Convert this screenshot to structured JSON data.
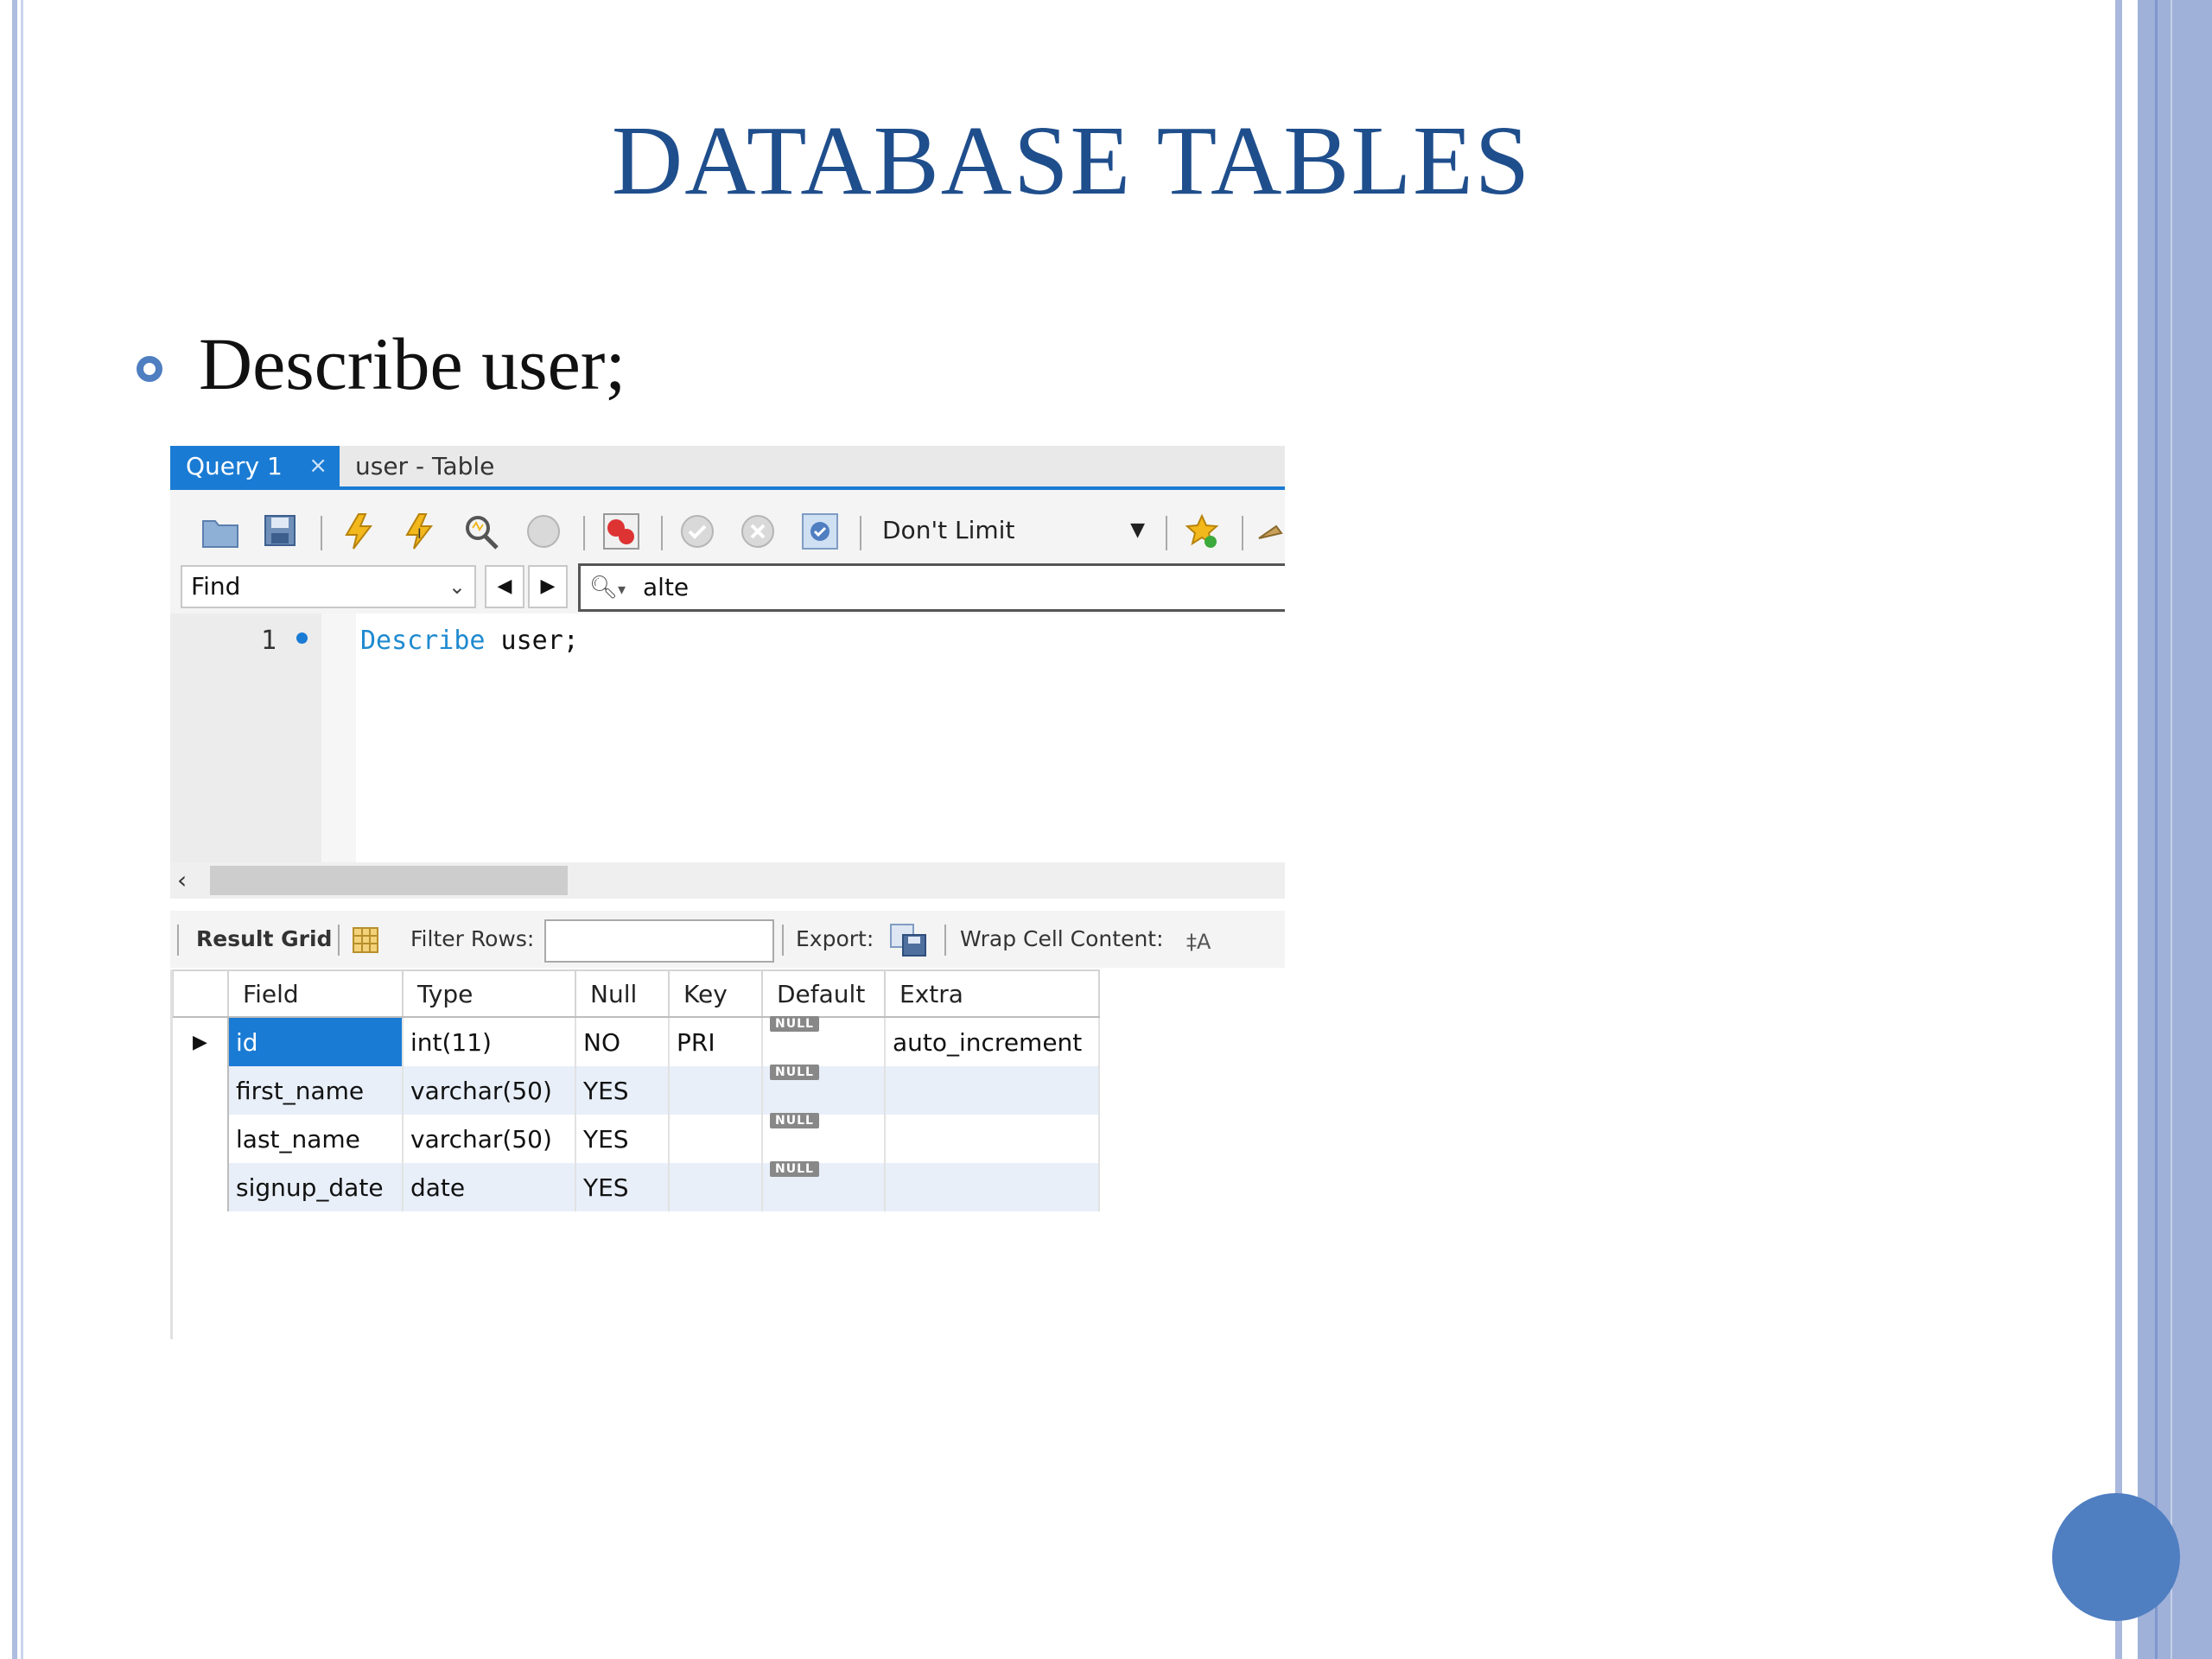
{
  "slide": {
    "title": "DATABASE TABLES",
    "bullet": "Describe user;"
  },
  "colors": {
    "title": "#1f4e8c",
    "accent": "#4f7ec1",
    "tab_active": "#1a7bd4",
    "keyword": "#1f8ad0"
  },
  "workbench": {
    "tabs": [
      {
        "label": "Query 1",
        "close": "×",
        "active": true
      },
      {
        "label": "user - Table",
        "active": false
      }
    ],
    "toolbar": {
      "icons": [
        "open-folder-icon",
        "save-icon",
        "execute-icon",
        "execute-current-icon",
        "explain-icon",
        "stop-icon",
        "toggle-error-icon",
        "commit-icon",
        "rollback-icon",
        "autocommit-icon",
        "bookmark-icon",
        "beautify-icon"
      ],
      "limit_select": "Don't Limit"
    },
    "find": {
      "mode": "Find",
      "search_value": "alte",
      "prev": "◀",
      "next": "▶"
    },
    "editor": {
      "line_number": "1",
      "keyword": "Describe",
      "rest": " user;"
    },
    "result_bar": {
      "result_grid": "Result Grid",
      "filter_rows": "Filter Rows:",
      "export": "Export:",
      "wrap": "Wrap Cell Content:"
    },
    "grid": {
      "columns": [
        "Field",
        "Type",
        "Null",
        "Key",
        "Default",
        "Extra"
      ],
      "rows": [
        {
          "field": "id",
          "type": "int(11)",
          "null": "NO",
          "key": "PRI",
          "default": "NULL",
          "extra": "auto_increment"
        },
        {
          "field": "first_name",
          "type": "varchar(50)",
          "null": "YES",
          "key": "",
          "default": "NULL",
          "extra": ""
        },
        {
          "field": "last_name",
          "type": "varchar(50)",
          "null": "YES",
          "key": "",
          "default": "NULL",
          "extra": ""
        },
        {
          "field": "signup_date",
          "type": "date",
          "null": "YES",
          "key": "",
          "default": "NULL",
          "extra": ""
        }
      ],
      "current_row_marker": "▶"
    }
  }
}
